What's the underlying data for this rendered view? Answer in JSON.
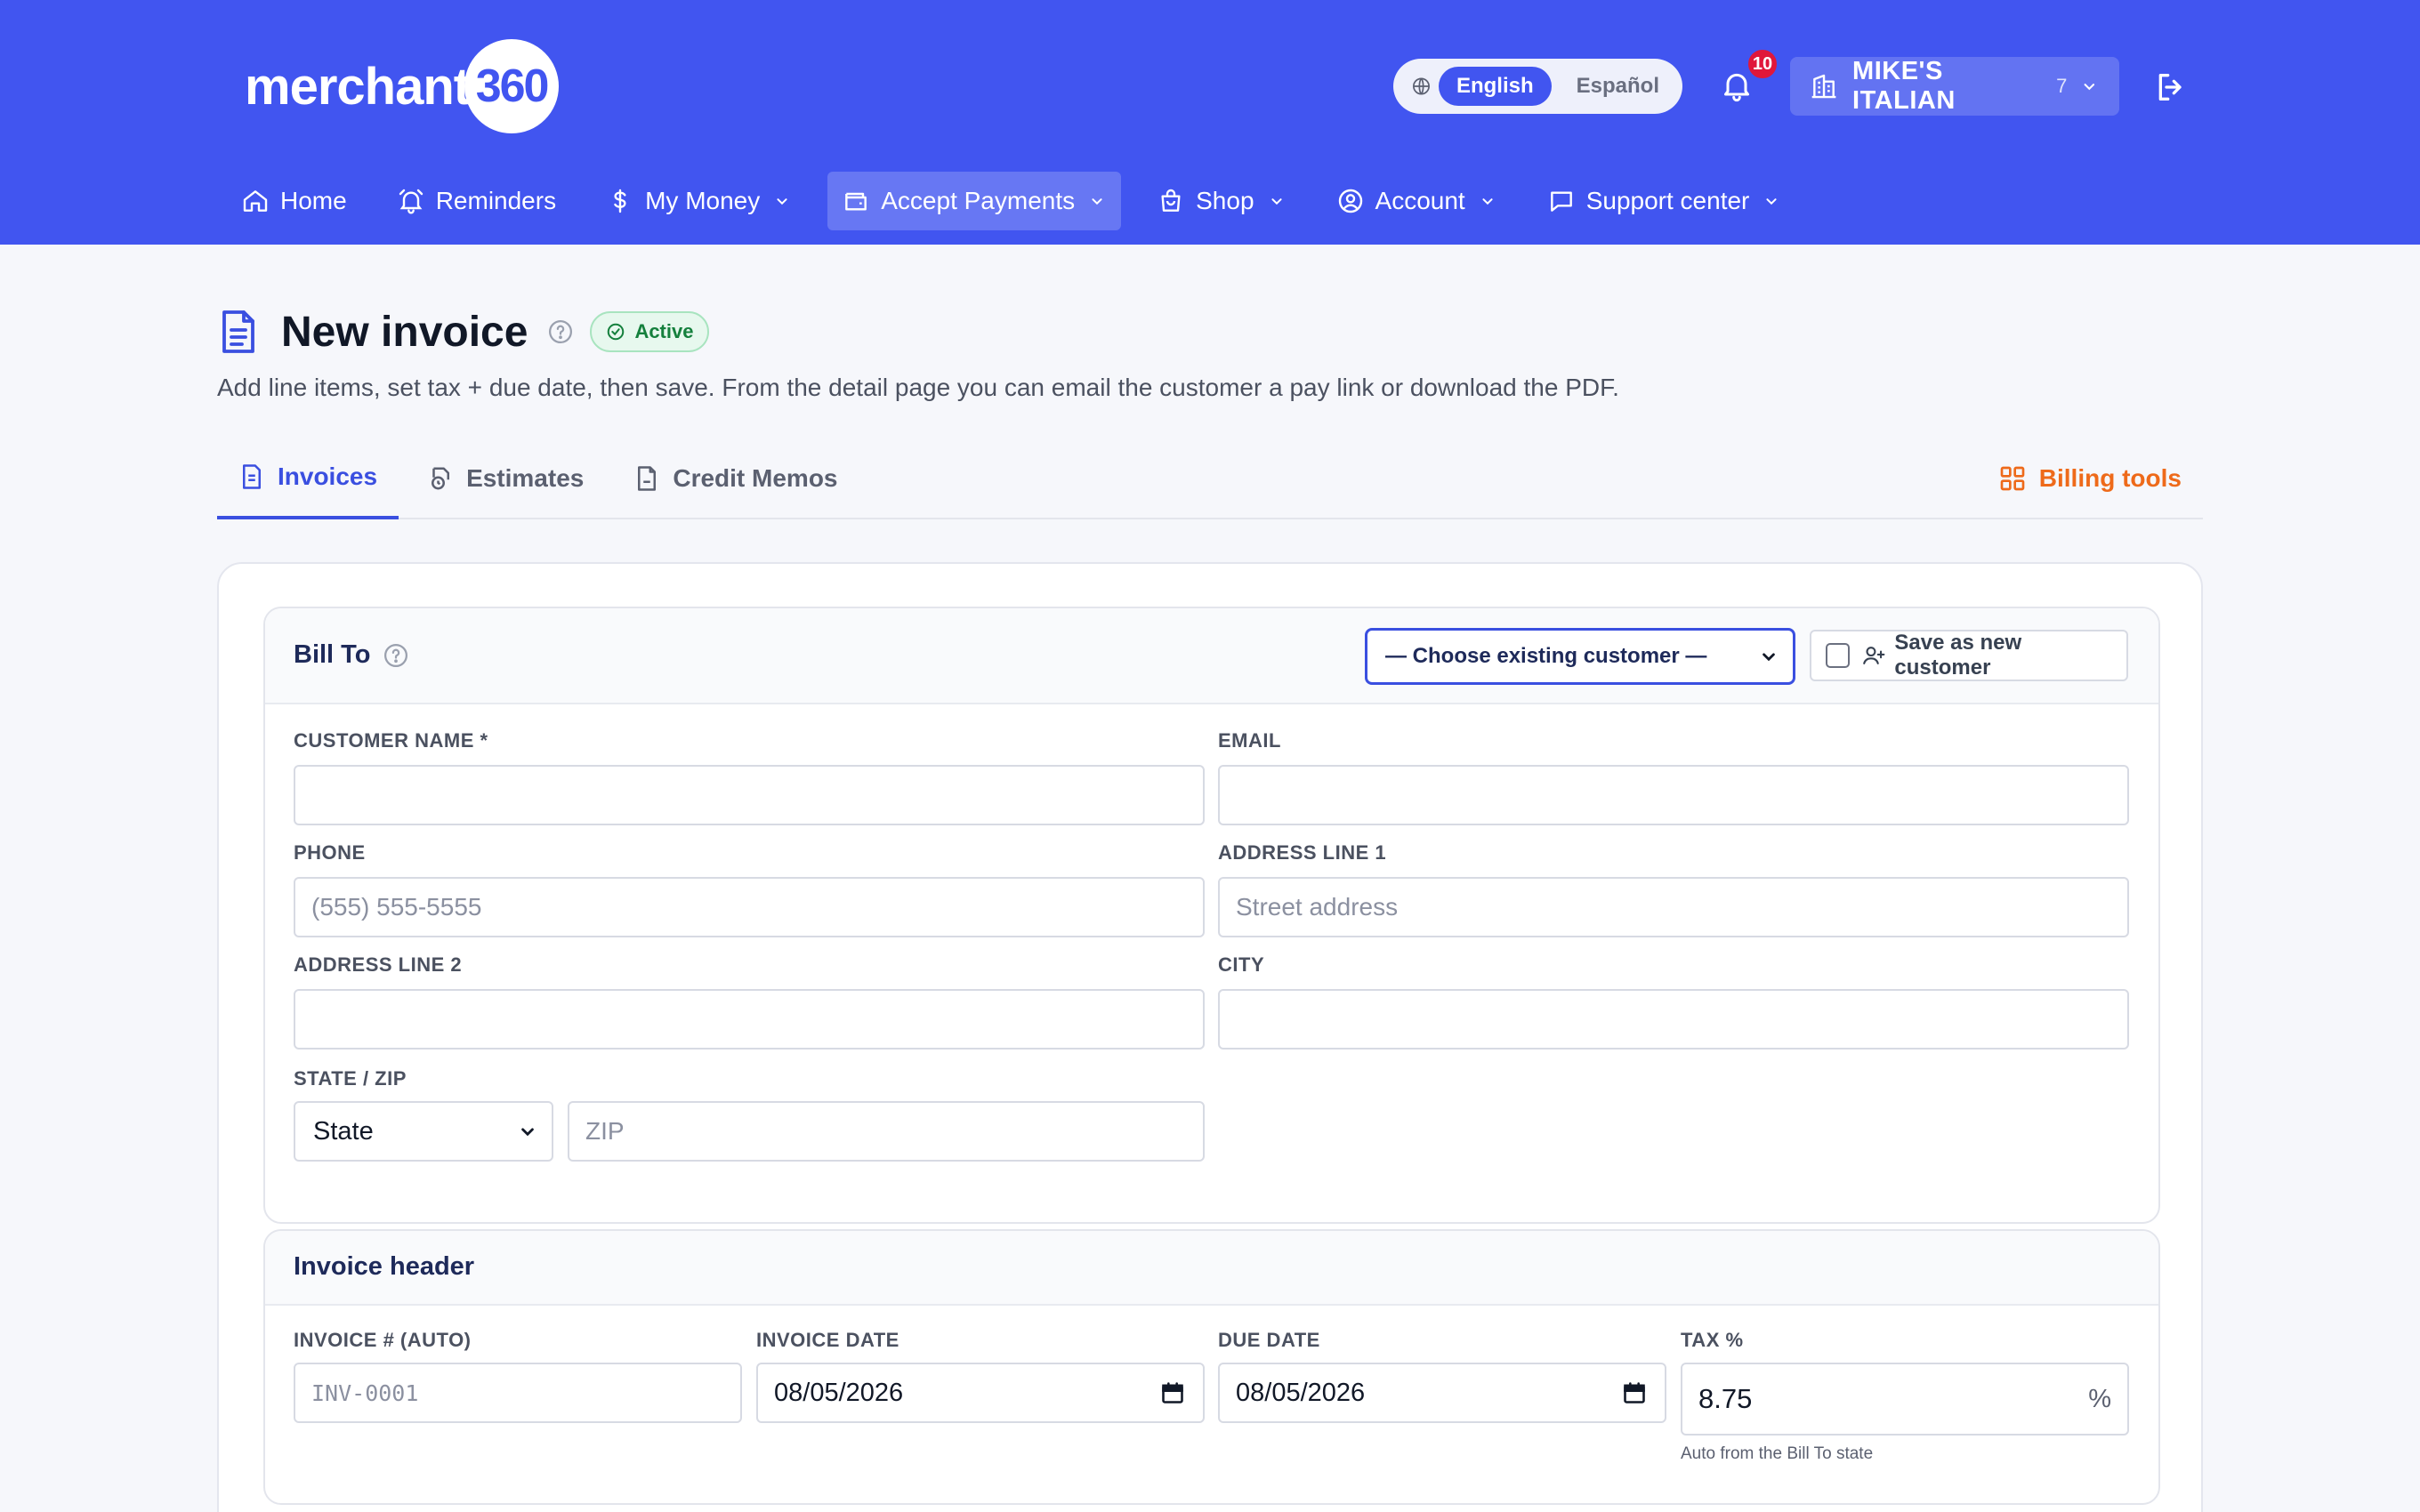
{
  "brand": {
    "logo_text": "merchant",
    "logo_badge": "360"
  },
  "language": {
    "active": "English",
    "inactive": "Español"
  },
  "notifications": {
    "count": "10"
  },
  "merchant": {
    "name": "MIKE'S ITALIAN",
    "count": "7"
  },
  "nav": {
    "home": "Home",
    "reminders": "Reminders",
    "my_money": "My Money",
    "accept_payments": "Accept Payments",
    "shop": "Shop",
    "account": "Account",
    "support": "Support center"
  },
  "page": {
    "title": "New invoice",
    "status": "Active",
    "subtitle": "Add line items, set tax + due date, then save. From the detail page you can email the customer a pay link or download the PDF."
  },
  "tabs": {
    "invoices": "Invoices",
    "estimates": "Estimates",
    "credit_memos": "Credit Memos",
    "billing_tools": "Billing tools"
  },
  "bill_to": {
    "title": "Bill To",
    "customer_select": "— Choose existing customer —",
    "save_new": "Save as new customer",
    "customer_name_label": "CUSTOMER NAME *",
    "email_label": "EMAIL",
    "phone_label": "PHONE",
    "phone_placeholder": "(555) 555-5555",
    "address1_label": "ADDRESS LINE 1",
    "address1_placeholder": "Street address",
    "address2_label": "ADDRESS LINE 2",
    "city_label": "CITY",
    "state_zip_label": "STATE / ZIP",
    "state_value": "State",
    "zip_placeholder": "ZIP"
  },
  "invoice_header": {
    "title": "Invoice header",
    "invoice_no_label": "INVOICE # (AUTO)",
    "invoice_no_placeholder": "INV-0001",
    "invoice_date_label": "INVOICE DATE",
    "invoice_date": "08/05/2026",
    "due_date_label": "DUE DATE",
    "due_date": "08/05/2026",
    "tax_label": "TAX %",
    "tax_value": "8.75",
    "tax_suffix": "%",
    "tax_hint": "Auto from the Bill To state"
  },
  "colors": {
    "brand_blue": "#4155f0",
    "accent_orange": "#ee6a1a",
    "status_green": "#15803d",
    "badge_red": "#e0173b"
  }
}
